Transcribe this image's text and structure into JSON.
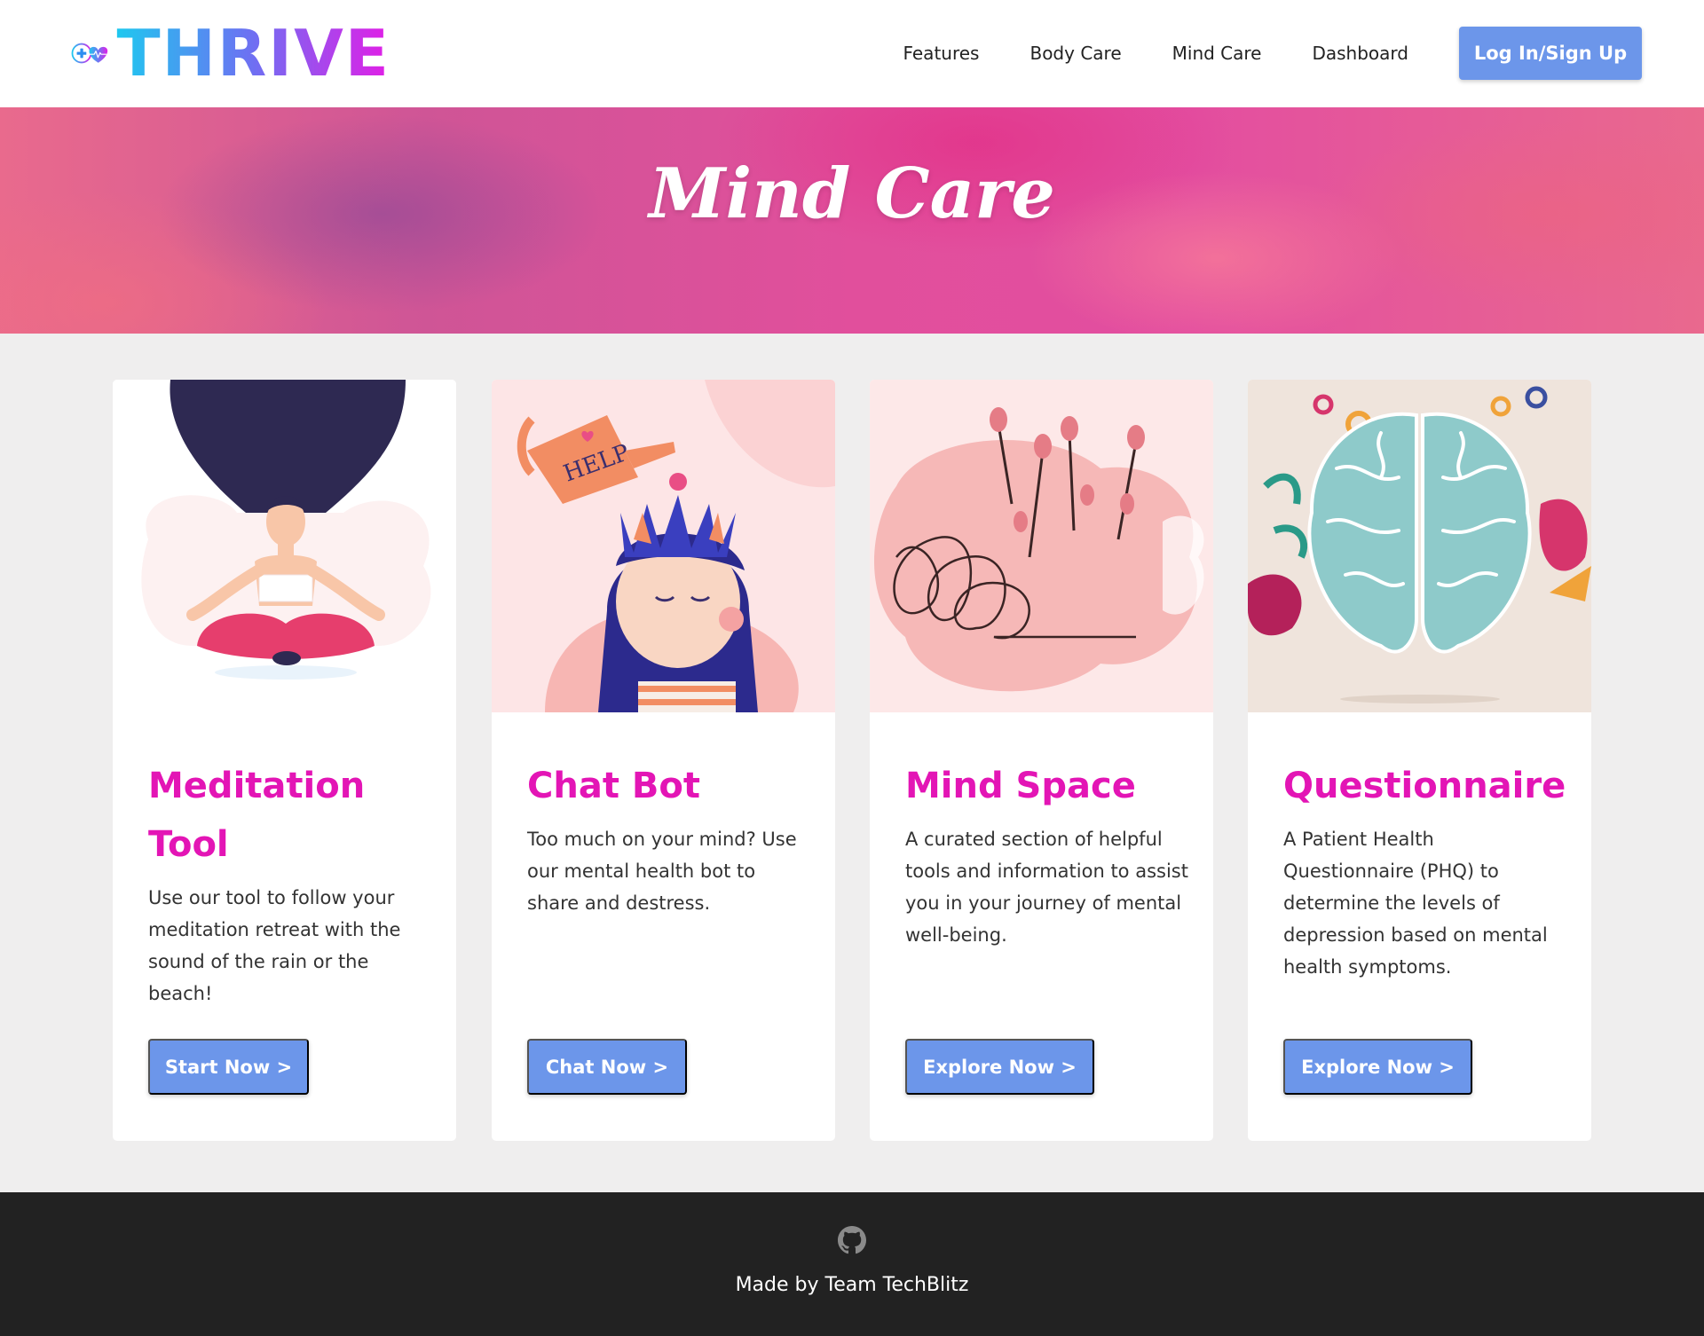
{
  "brand": {
    "name": "THRIVE"
  },
  "nav": {
    "items": [
      "Features",
      "Body Care",
      "Mind Care",
      "Dashboard"
    ],
    "login_label": "Log In/Sign Up"
  },
  "hero": {
    "title": "Mind Care"
  },
  "cards": [
    {
      "title": "Meditation Tool",
      "description": "Use our tool to follow your meditation retreat with the sound of the rain or the beach!",
      "button": "Start Now >",
      "image_icon": "meditation-illustration"
    },
    {
      "title": "Chat Bot",
      "description": "Too much on your mind? Use our mental health bot to share and destress.",
      "button": "Chat Now >",
      "image_icon": "watering-can-illustration"
    },
    {
      "title": "Mind Space",
      "description": "A curated section of helpful tools and information to assist you in your journey of mental well-being.",
      "button": "Explore Now >",
      "image_icon": "tangled-mind-illustration"
    },
    {
      "title": "Questionnaire",
      "description": "A Patient Health Questionnaire (PHQ) to determine the levels of depression based on mental health symptoms.",
      "button": "Explore Now >",
      "image_icon": "brain-illustration"
    }
  ],
  "footer": {
    "text": "Made by Team TechBlitz",
    "icon": "github-icon"
  },
  "colors": {
    "accent": "#e315b5",
    "button": "#6c96ea",
    "footer": "#222222",
    "background": "#efeeee"
  }
}
